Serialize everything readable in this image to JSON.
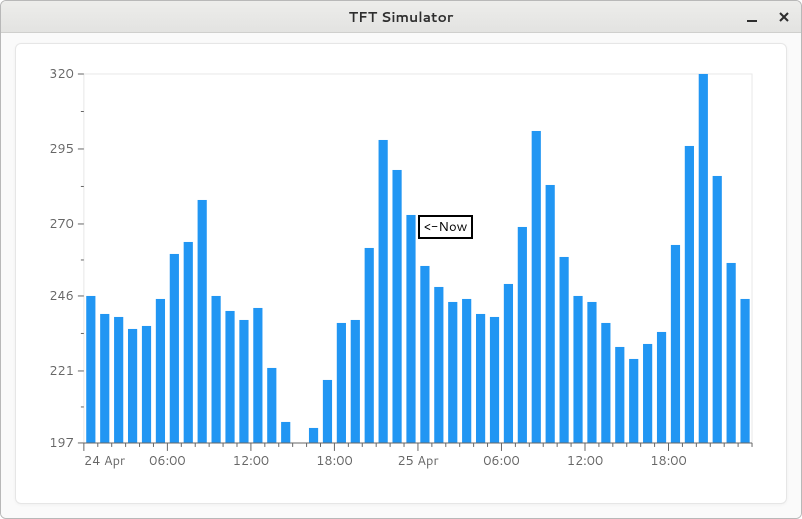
{
  "window": {
    "title": "TFT Simulator"
  },
  "annotation": {
    "now_label": "<-Now"
  },
  "chart_data": {
    "type": "bar",
    "title": "",
    "xlabel": "",
    "ylabel": "",
    "ylim": [
      197,
      320
    ],
    "y_ticks": [
      197,
      221,
      246,
      270,
      295,
      320
    ],
    "x_tick_labels": [
      "24 Apr",
      "06:00",
      "12:00",
      "18:00",
      "25 Apr",
      "06:00",
      "12:00",
      "18:00"
    ],
    "x_major_indices": [
      0,
      6,
      12,
      18,
      24,
      30,
      36,
      42
    ],
    "bar_color": "#2196f3",
    "annotation_index": 24,
    "values": [
      246,
      240,
      239,
      235,
      236,
      245,
      260,
      264,
      278,
      246,
      241,
      238,
      242,
      222,
      204,
      197,
      202,
      218,
      237,
      238,
      262,
      298,
      288,
      273,
      256,
      249,
      244,
      245,
      240,
      239,
      250,
      269,
      301,
      283,
      259,
      246,
      244,
      237,
      229,
      225,
      230,
      234,
      263,
      296,
      320,
      286,
      257,
      245
    ]
  }
}
